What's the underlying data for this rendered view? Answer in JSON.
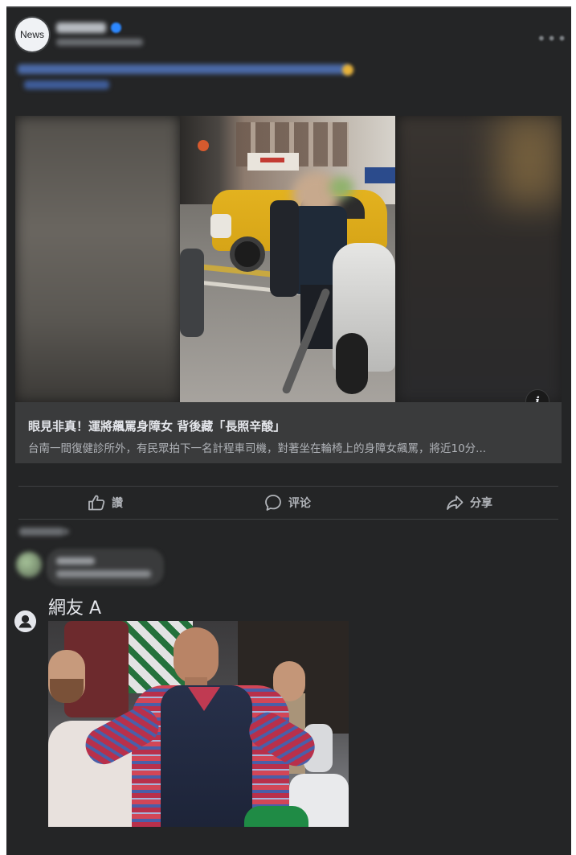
{
  "post": {
    "avatar_text": "News",
    "video": {
      "info_icon": "i"
    },
    "link_preview": {
      "title": "眼見非真！運將飆罵身障女 背後藏「長照辛酸」",
      "description": "台南一間復健診所外，有民眾拍下一名計程車司機，對著坐在輪椅上的身障女飆罵，將近10分..."
    },
    "actions": {
      "like_label": "讚",
      "comment_label": "评论",
      "share_label": "分享"
    }
  },
  "reply": {
    "author": "網友 A"
  },
  "colors": {
    "card_bg": "#242526",
    "preview_bg": "#3a3b3c",
    "primary_text": "#e4e6eb",
    "secondary_text": "#b0b3b8"
  },
  "icons": [
    "more-options-icon",
    "verified-badge-icon",
    "info-icon",
    "like-thumb-icon",
    "comment-bubble-icon",
    "share-arrow-icon",
    "user-avatar-icon"
  ]
}
